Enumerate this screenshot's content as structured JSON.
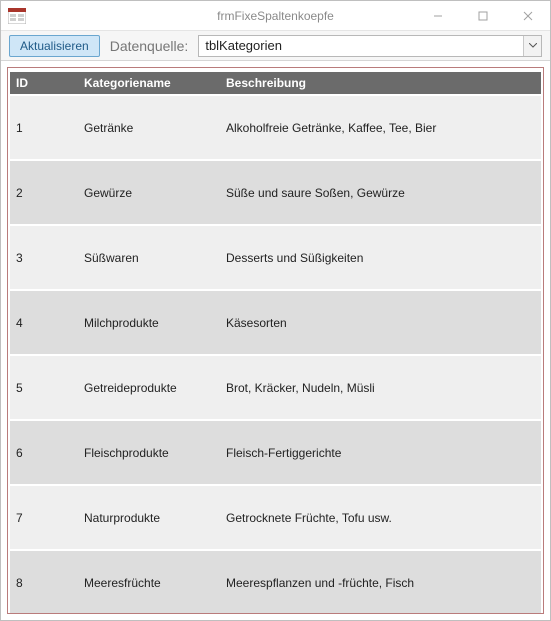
{
  "window": {
    "title": "frmFixeSpaltenkoepfe"
  },
  "toolbar": {
    "refresh_label": "Aktualisieren",
    "datasource_label": "Datenquelle:",
    "datasource_value": "tblKategorien"
  },
  "grid": {
    "columns": {
      "id": "ID",
      "name": "Kategoriename",
      "desc": "Beschreibung"
    },
    "rows": [
      {
        "id": "1",
        "name": "Getränke",
        "desc": "Alkoholfreie Getränke, Kaffee, Tee, Bier"
      },
      {
        "id": "2",
        "name": "Gewürze",
        "desc": "Süße und saure Soßen, Gewürze"
      },
      {
        "id": "3",
        "name": "Süßwaren",
        "desc": "Desserts und Süßigkeiten"
      },
      {
        "id": "4",
        "name": "Milchprodukte",
        "desc": "Käsesorten"
      },
      {
        "id": "5",
        "name": "Getreideprodukte",
        "desc": "Brot, Kräcker, Nudeln, Müsli"
      },
      {
        "id": "6",
        "name": "Fleischprodukte",
        "desc": "Fleisch-Fertiggerichte"
      },
      {
        "id": "7",
        "name": "Naturprodukte",
        "desc": "Getrocknete Früchte, Tofu usw."
      },
      {
        "id": "8",
        "name": "Meeresfrüchte",
        "desc": "Meerespflanzen und -früchte, Fisch"
      }
    ]
  }
}
